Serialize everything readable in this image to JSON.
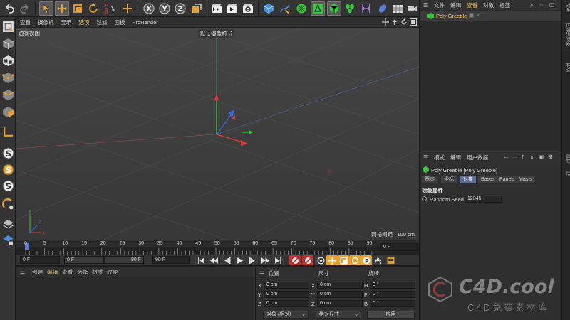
{
  "viewport": {
    "menu": [
      "查看",
      "摄像机",
      "显示",
      "选项",
      "过滤",
      "面板",
      "ProRender"
    ],
    "active_menu_index": 3,
    "view_name": "透视视图",
    "camera_label": "默认摄像机",
    "grid_spacing": "网格间距 : 100 cm"
  },
  "timeline": {
    "ticks": [
      "0",
      "5",
      "10",
      "15",
      "20",
      "25",
      "30",
      "35",
      "40",
      "45",
      "50",
      "55",
      "60",
      "65",
      "70",
      "75",
      "80",
      "85",
      "90"
    ],
    "current_frame": "0 F",
    "start_frame": "0 F",
    "min_field": "0 F",
    "max_field": "90 F",
    "end_frame": "90 F"
  },
  "materials": {
    "menu": [
      "创建",
      "编辑",
      "查看",
      "选择",
      "材质",
      "纹理"
    ],
    "active_index": 1
  },
  "coordinates": {
    "headers": [
      "位置",
      "尺寸",
      "旋转"
    ],
    "rows": [
      {
        "axis": "X",
        "pos": "0 cm",
        "size_axis": "X",
        "size": "0 cm",
        "rot_axis": "H",
        "rot": "0 °"
      },
      {
        "axis": "Y",
        "pos": "0 cm",
        "size_axis": "Y",
        "size": "0 cm",
        "rot_axis": "P",
        "rot": "0 °"
      },
      {
        "axis": "Z",
        "pos": "0 cm",
        "size_axis": "Z",
        "size": "0 cm",
        "rot_axis": "B",
        "rot": "0 °"
      }
    ],
    "mode_dropdown": "对象 (相对)",
    "size_dropdown": "绝对尺寸",
    "apply": "应用"
  },
  "object_manager": {
    "menu": [
      "文件",
      "编辑",
      "查看",
      "对象",
      "标签"
    ],
    "active_index": 2,
    "objects": [
      {
        "name": "Poly Greeble"
      }
    ]
  },
  "attributes": {
    "menu": [
      "模式",
      "编辑",
      "用户数据"
    ],
    "object_title": "Poly Greeble [Poly Greeble]",
    "tabs": [
      "基本",
      "坐标",
      "对象",
      "Bases",
      "Panels",
      "Masts"
    ],
    "active_tab": 2,
    "section": "对象属性",
    "param_label": "Random Seed",
    "param_value": "12345"
  },
  "side_tabs": [
    "对象",
    "内容浏览器",
    "构造",
    "属性",
    "层"
  ],
  "watermark": {
    "main": "C4D.cool",
    "sub": "C4D免费素材库"
  },
  "colors": {
    "accent": "#e8c06a",
    "selection_tab": "#5b6f9a",
    "axis_x": "#e03a3a",
    "axis_y": "#3ac53a",
    "axis_z": "#3a6ae0"
  }
}
